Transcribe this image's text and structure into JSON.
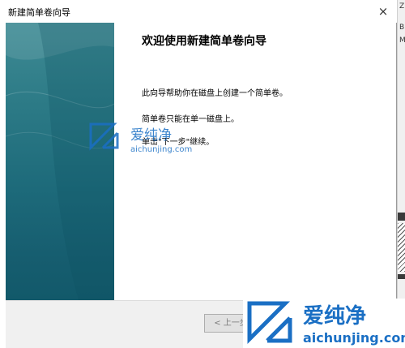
{
  "dialog": {
    "title": "新建简单卷向导",
    "close_label": "×",
    "heading": "欢迎使用新建简单卷向导",
    "paragraphs": [
      "此向导帮助你在磁盘上创建一个简单卷。",
      "简单卷只能在单一磁盘上。",
      "单击\"下一步\"继续。"
    ],
    "back_button": "< 上一步"
  },
  "watermark": {
    "brand_cn": "爱纯净",
    "brand_url": "aichunjing.com"
  },
  "background_window": {
    "snippets": [
      "Z",
      "B",
      "M"
    ]
  },
  "colors": {
    "banner_top": "#3f8b94",
    "banner_bottom": "#12596a",
    "watermark_blue": "#1a6fc4",
    "footer_bg": "#f0f0f0"
  }
}
